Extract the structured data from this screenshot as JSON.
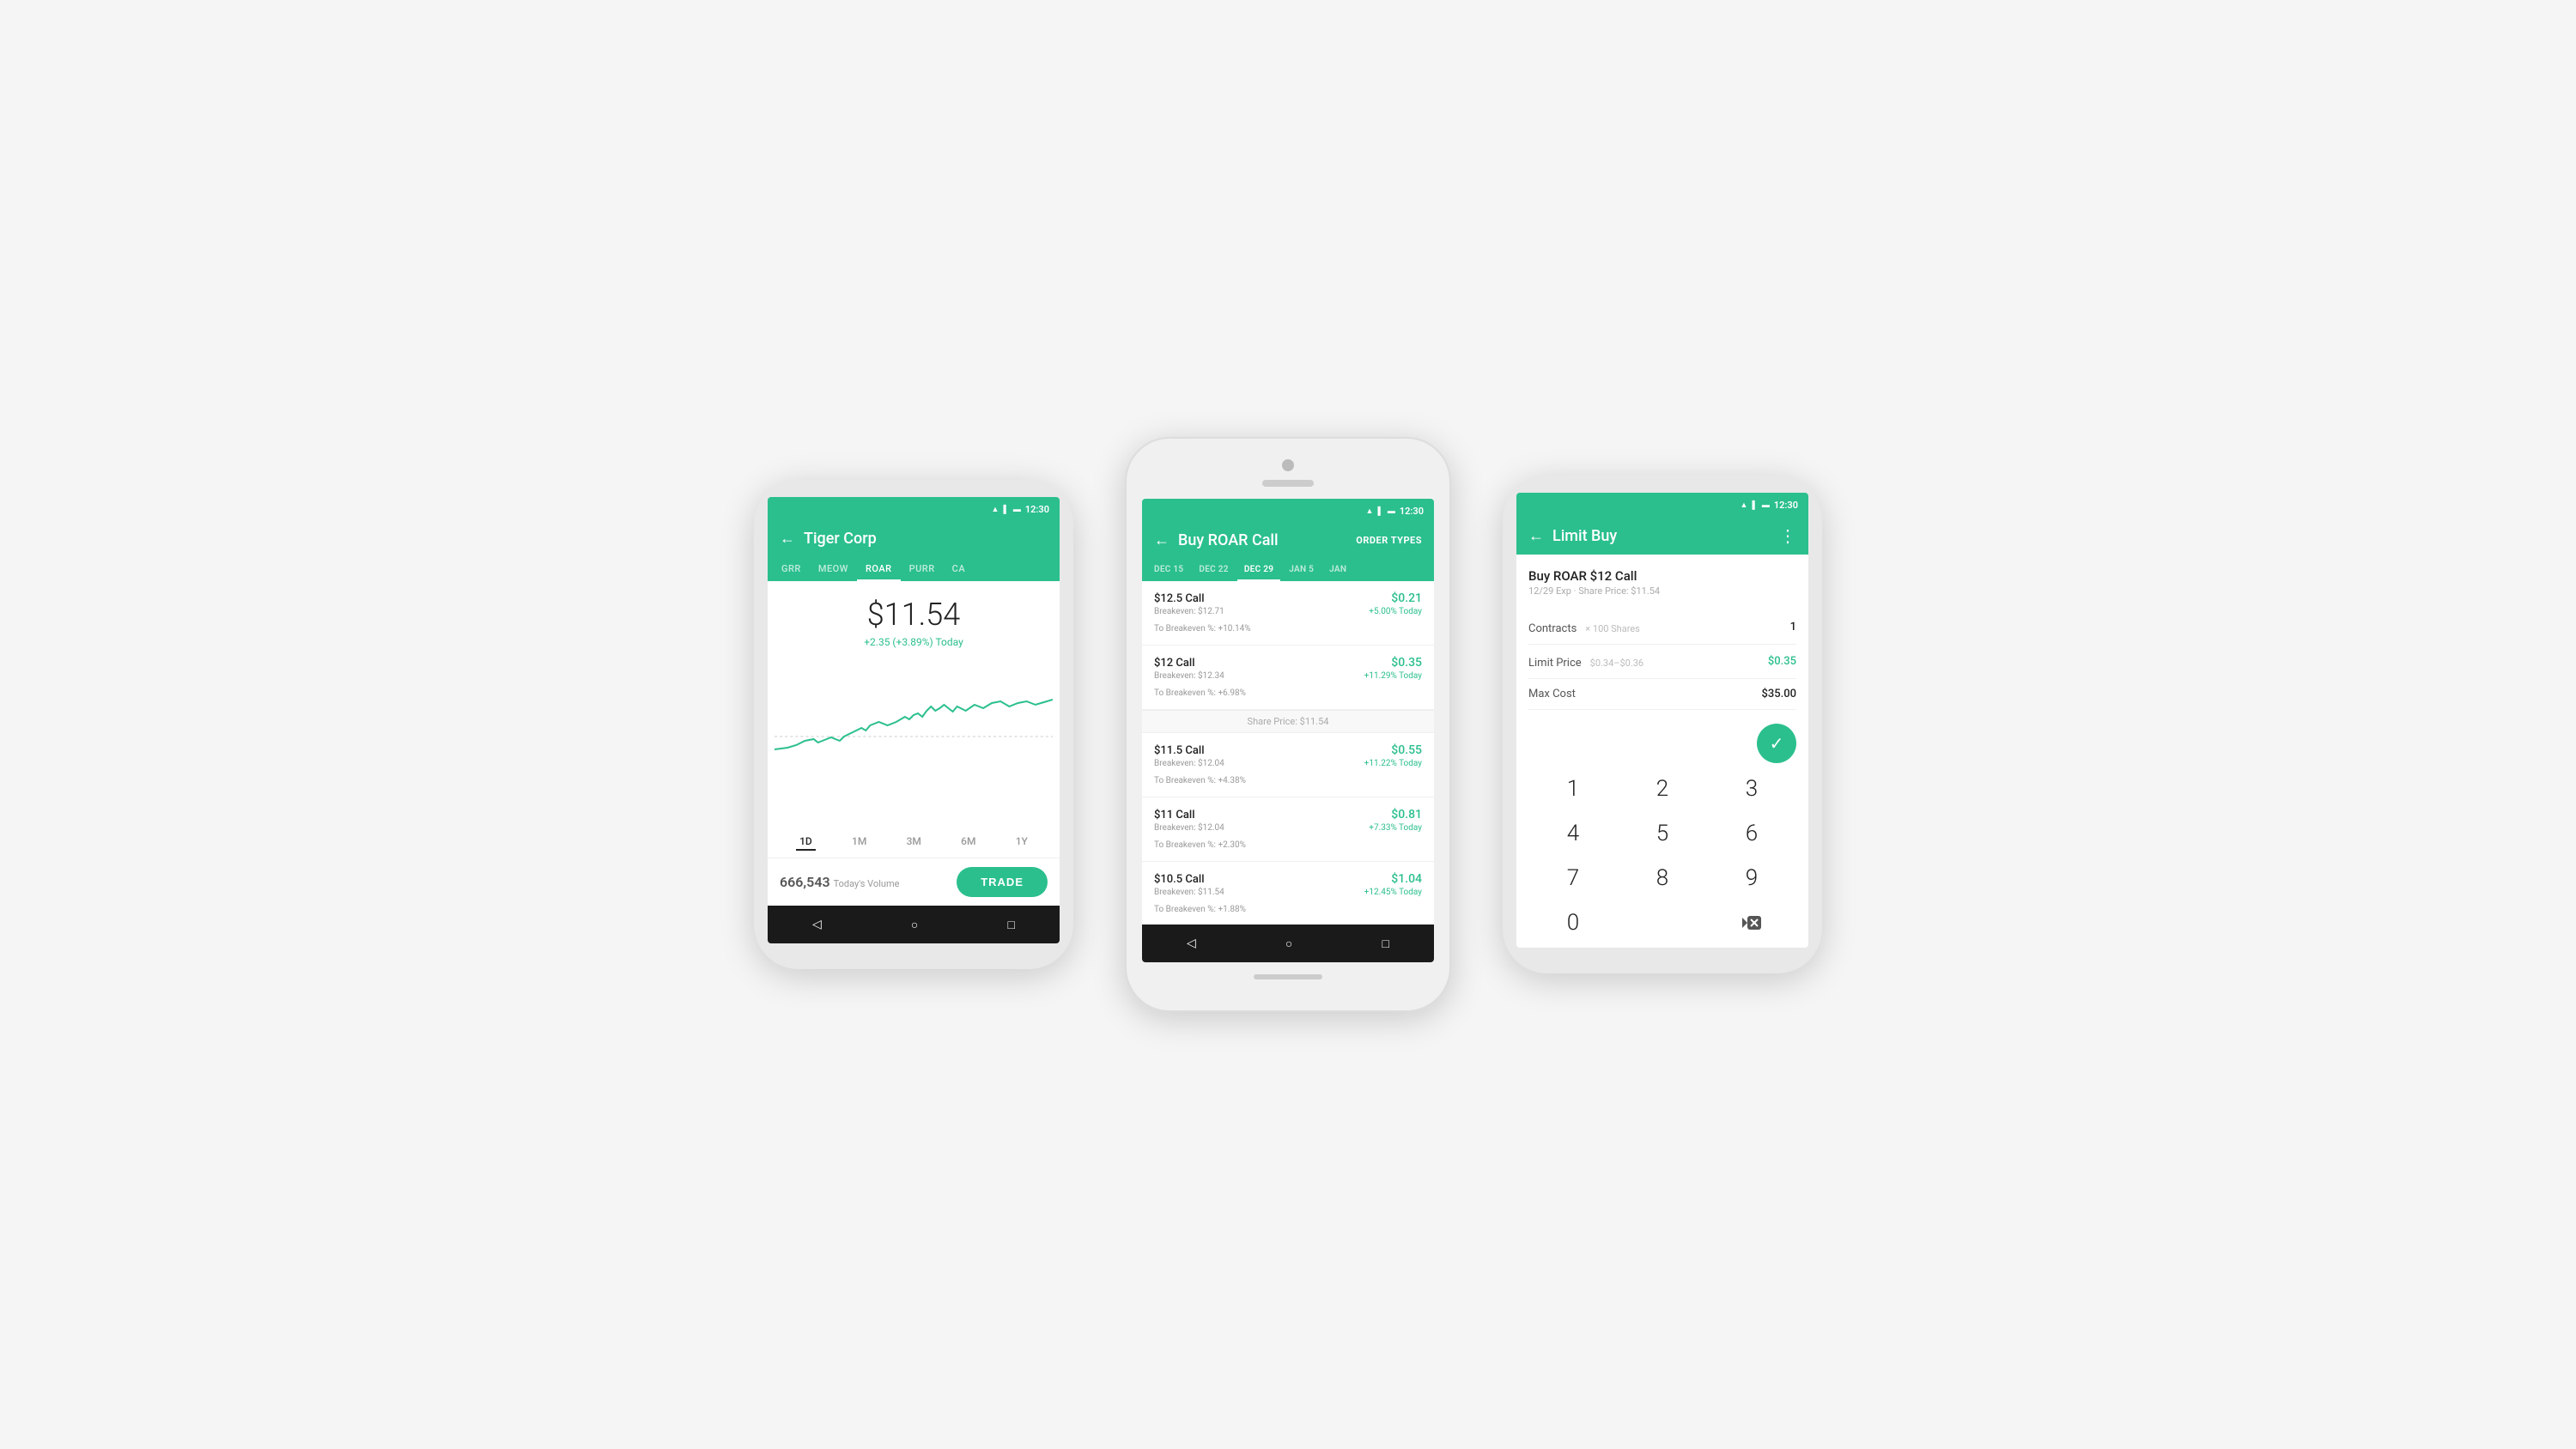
{
  "scene": {
    "bg_color": "#f5f5f5"
  },
  "phone1": {
    "status_time": "12:30",
    "header_title": "Tiger Corp",
    "ticker_tabs": [
      "GRR",
      "MEOW",
      "ROAR",
      "PURR",
      "CA"
    ],
    "active_ticker": "ROAR",
    "stock_price": "$11.54",
    "stock_change": "+2.35 (+3.89%) Today",
    "time_periods": [
      "1D",
      "1M",
      "3M",
      "6M",
      "1Y"
    ],
    "active_period": "1D",
    "volume_label": "Today's Volume",
    "volume_number": "666,543",
    "trade_btn": "TRADE",
    "nav_back": "◁",
    "nav_home": "○",
    "nav_square": "□"
  },
  "phone2": {
    "status_time": "12:30",
    "header_back": "←",
    "header_title": "Buy ROAR Call",
    "header_action": "ORDER TYPES",
    "date_tabs": [
      "DEC 15",
      "DEC 22",
      "DEC 29",
      "JAN 5",
      "JAN"
    ],
    "active_date": "DEC 29",
    "share_price_divider": "Share Price: $11.54",
    "options": [
      {
        "name": "$12.5 Call",
        "price": "$0.21",
        "breakeven": "Breakeven: $12.71",
        "change": "+5.00% Today",
        "to_breakeven": "To Breakeven %: +10.14%"
      },
      {
        "name": "$12 Call",
        "price": "$0.35",
        "breakeven": "Breakeven: $12.34",
        "change": "+11.29% Today",
        "to_breakeven": "To Breakeven %: +6.98%"
      },
      {
        "name": "$11.5 Call",
        "price": "$0.55",
        "breakeven": "Breakeven: $12.04",
        "change": "+11.22% Today",
        "to_breakeven": "To Breakeven %: +4.38%"
      },
      {
        "name": "$11 Call",
        "price": "$0.81",
        "breakeven": "Breakeven: $12.04",
        "change": "+7.33% Today",
        "to_breakeven": "To Breakeven %: +2.30%"
      },
      {
        "name": "$10.5 Call",
        "price": "$1.04",
        "breakeven": "Breakeven: $11.54",
        "change": "+12.45% Today",
        "to_breakeven": "To Breakeven %: +1.88%"
      }
    ],
    "nav_back": "◁",
    "nav_home": "○",
    "nav_square": "□"
  },
  "phone3": {
    "status_time": "12:30",
    "header_back": "←",
    "header_title": "Limit Buy",
    "header_dots": "⋮",
    "order_title": "Buy ROAR $12 Call",
    "order_subtitle": "12/29 Exp · Share Price: $11.54",
    "contracts_label": "Contracts",
    "contracts_sublabel": "× 100 Shares",
    "contracts_value": "1",
    "limit_price_label": "Limit Price",
    "limit_price_range": "$0.34–$0.36",
    "limit_price_value": "$0.35",
    "max_cost_label": "Max Cost",
    "max_cost_value": "$35.00",
    "confirm_icon": "✓",
    "numpad_keys": [
      "1",
      "2",
      "3",
      "4",
      "5",
      "6",
      "7",
      "8",
      "9",
      "0",
      "⌫"
    ],
    "nav_back": "◁",
    "nav_home": "○",
    "nav_square": "□"
  }
}
